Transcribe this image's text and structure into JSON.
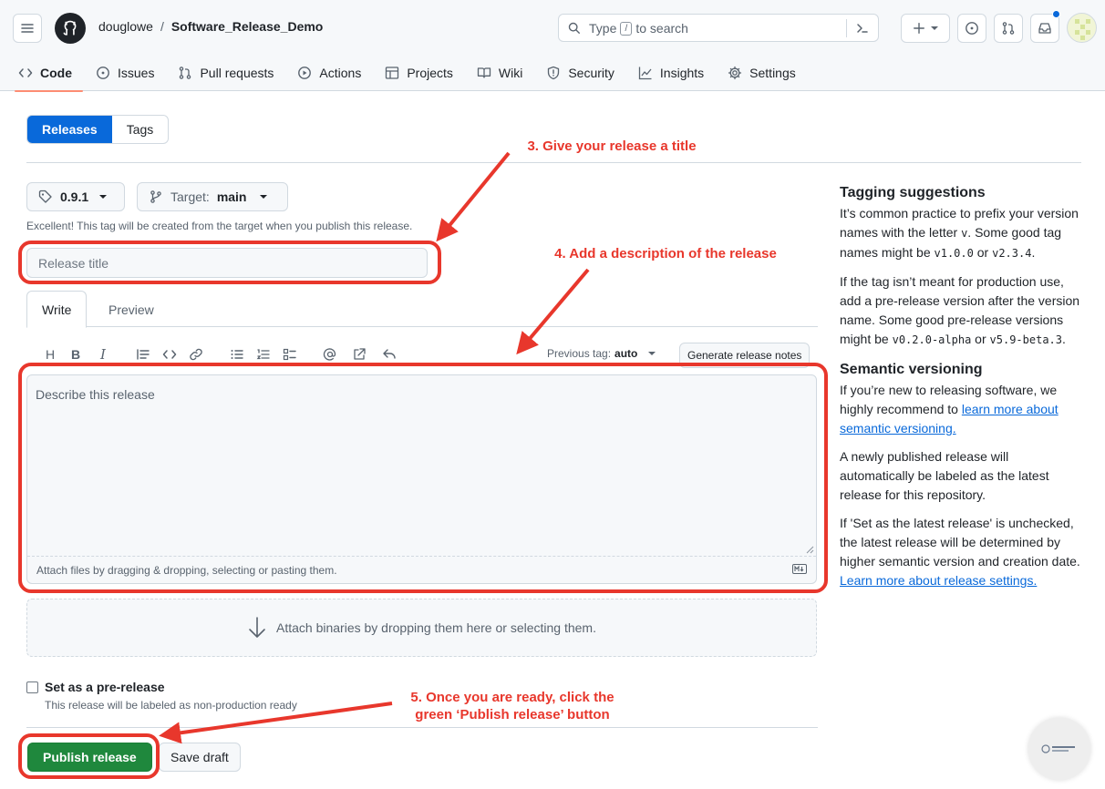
{
  "header": {
    "owner": "douglowe",
    "separator": "/",
    "repo": "Software_Release_Demo",
    "search_prefix": "Type",
    "search_key": "/",
    "search_suffix": "to search"
  },
  "nav_tabs": [
    {
      "label": "Code",
      "icon": "code-icon"
    },
    {
      "label": "Issues",
      "icon": "issue-icon"
    },
    {
      "label": "Pull requests",
      "icon": "pull-request-icon"
    },
    {
      "label": "Actions",
      "icon": "play-icon"
    },
    {
      "label": "Projects",
      "icon": "table-icon"
    },
    {
      "label": "Wiki",
      "icon": "book-icon"
    },
    {
      "label": "Security",
      "icon": "shield-icon"
    },
    {
      "label": "Insights",
      "icon": "graph-icon"
    },
    {
      "label": "Settings",
      "icon": "gear-icon"
    }
  ],
  "subnav": {
    "releases": "Releases",
    "tags": "Tags"
  },
  "form": {
    "tag": "0.9.1",
    "target_label": "Target:",
    "target_value": "main",
    "tag_hint": "Excellent! This tag will be created from the target when you publish this release.",
    "title_placeholder": "Release title",
    "tab_write": "Write",
    "tab_preview": "Preview",
    "previous_tag_label": "Previous tag:",
    "previous_tag_value": "auto",
    "generate_notes": "Generate release notes",
    "body_placeholder": "Describe this release",
    "attach_hint": "Attach files by dragging & dropping, selecting or pasting them.",
    "binaries_hint": "Attach binaries by dropping them here or selecting them.",
    "prerelease_label": "Set as a pre-release",
    "prerelease_sub": "This release will be labeled as non-production ready",
    "publish": "Publish release",
    "save_draft": "Save draft"
  },
  "sidebar": {
    "tagging_title": "Tagging suggestions",
    "tagging_p1_a": "It’s common practice to prefix your version names with the letter ",
    "tagging_p1_code1": "v",
    "tagging_p1_b": ". Some good tag names might be ",
    "tagging_p1_code2": "v1.0.0",
    "tagging_p1_c": " or ",
    "tagging_p1_code3": "v2.3.4",
    "tagging_p1_d": ".",
    "tagging_p2_a": "If the tag isn’t meant for production use, add a pre-release version after the version name. Some good pre-release versions might be ",
    "tagging_p2_code1": "v0.2.0-alpha",
    "tagging_p2_b": " or ",
    "tagging_p2_code2": "v5.9-beta.3",
    "tagging_p2_c": ".",
    "semver_title": "Semantic versioning",
    "semver_p1_a": "If you’re new to releasing software, we highly recommend to ",
    "semver_p1_link": "learn more about semantic versioning.",
    "semver_p2": "A newly published release will automatically be labeled as the latest release for this repository.",
    "semver_p3_a": "If 'Set as the latest release' is unchecked, the latest release will be determined by higher semantic version and creation date. ",
    "semver_p3_link": "Learn more about release settings."
  },
  "annotations": {
    "step3": "3. Give your release a title",
    "step4": "4. Add a description of the release",
    "step5_line1": "5. Once you are ready, click the",
    "step5_line2": "green ‘Publish release’ button",
    "color": "#e8372c"
  },
  "colors": {
    "primary_blue": "#0969da",
    "publish_green": "#1f883d",
    "active_tab_underline": "#fd8c73",
    "notification_dot": "#0969da"
  }
}
